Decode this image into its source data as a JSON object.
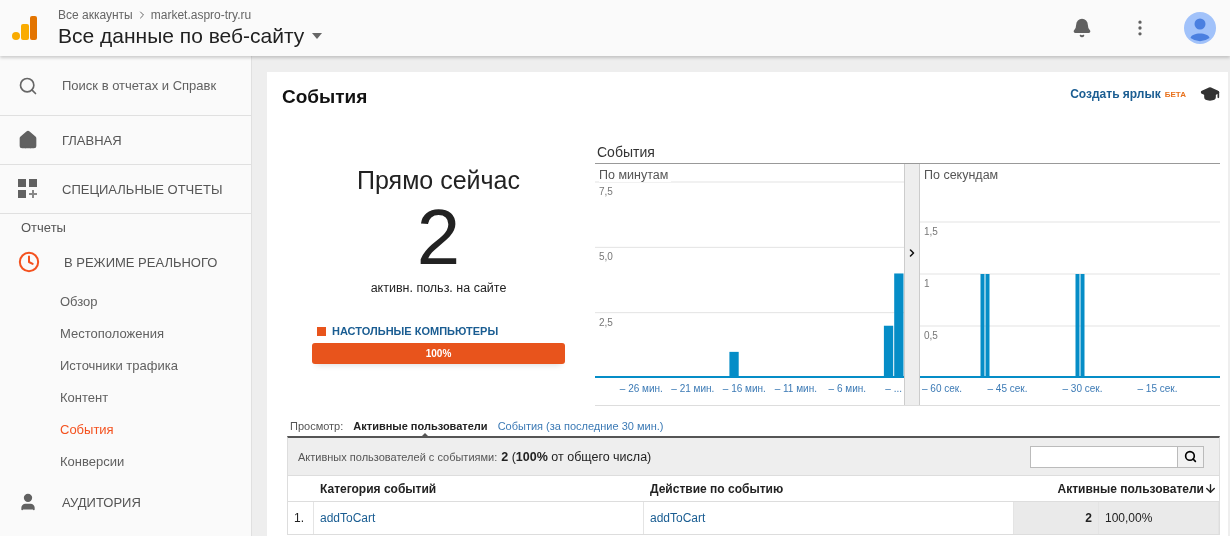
{
  "header": {
    "breadcrumb": [
      "Все аккаунты",
      "market.aspro-try.ru"
    ],
    "title": "Все данные по веб-сайту"
  },
  "sidebar": {
    "search": {
      "placeholder": "Поиск в отчетах и Справк"
    },
    "items": [
      {
        "kind": "home",
        "label": "ГЛАВНАЯ"
      },
      {
        "kind": "custom",
        "label": "СПЕЦИАЛЬНЫЕ ОТЧЕТЫ"
      },
      {
        "kind": "heading",
        "label": "Отчеты"
      },
      {
        "kind": "realtime",
        "label": "В РЕЖИМЕ РЕАЛЬНОГО",
        "expanded": true,
        "children": [
          {
            "label": "Обзор",
            "selected": false
          },
          {
            "label": "Местоположения",
            "selected": false
          },
          {
            "label": "Источники трафика",
            "selected": false
          },
          {
            "label": "Контент",
            "selected": false
          },
          {
            "label": "События",
            "selected": true
          },
          {
            "label": "Конверсии",
            "selected": false
          }
        ]
      },
      {
        "kind": "audience",
        "label": "АУДИТОРИЯ"
      }
    ]
  },
  "report": {
    "title": "События",
    "shortcut": "Создать ярлык",
    "badge": "БЕТА",
    "now": {
      "heading": "Прямо сейчас",
      "count": "2",
      "caption": "активн. польз. на сайте",
      "device": {
        "label": "НАСТОЛЬНЫЕ КОМПЬЮТЕРЫ",
        "color": "#e8541c",
        "level": 1,
        "reading": "100%"
      }
    },
    "charts_title": "События",
    "charts": [
      {
        "chart_data": {
          "type": "bar",
          "title": "По минутам",
          "categories": [
            null,
            null,
            null,
            null,
            "– 26 мин.",
            null,
            null,
            null,
            null,
            "– 21 мин.",
            null,
            null,
            null,
            null,
            "– 16 мин.",
            null,
            null,
            null,
            null,
            "– 11 мин.",
            null,
            null,
            null,
            null,
            "– 6 мин.",
            null,
            null,
            null,
            null,
            "– ..."
          ],
          "series": [
            {
              "color": "#058dc7",
              "values": [
                0,
                0,
                0,
                0,
                0,
                0,
                0,
                0,
                0,
                0,
                0,
                0,
                0,
                1,
                0,
                0,
                0,
                0,
                0,
                0,
                0,
                0,
                0,
                0,
                0,
                0,
                0,
                0,
                2,
                4
              ]
            }
          ],
          "ylim": [
            0,
            7.5
          ],
          "yticks": [
            {
              "value": 2.5,
              "label": "2,5"
            },
            {
              "value": 5,
              "label": "5,0"
            },
            {
              "value": 7.5,
              "label": "7,5"
            }
          ],
          "grid": true
        }
      },
      {
        "chart_data": {
          "type": "bar",
          "title": "По секундам",
          "categories": [
            null,
            null,
            "– 60 сек.",
            null,
            null,
            null,
            null,
            null,
            null,
            null,
            null,
            null,
            null,
            null,
            null,
            null,
            null,
            "– 45 сек.",
            null,
            null,
            null,
            null,
            null,
            null,
            null,
            null,
            null,
            null,
            null,
            null,
            null,
            null,
            "– 30 сек.",
            null,
            null,
            null,
            null,
            null,
            null,
            null,
            null,
            null,
            null,
            null,
            null,
            null,
            null,
            "– 15 сек.",
            null,
            null,
            null,
            null,
            null,
            null,
            null,
            null,
            null,
            null,
            null,
            null
          ],
          "series": [
            {
              "color": "#058dc7",
              "values": [
                null,
                null,
                null,
                null,
                null,
                null,
                null,
                null,
                null,
                null,
                null,
                null,
                1,
                1,
                null,
                null,
                null,
                null,
                null,
                null,
                null,
                null,
                null,
                null,
                null,
                null,
                null,
                null,
                null,
                null,
                null,
                1,
                1,
                null,
                null,
                null,
                null,
                null,
                null,
                null,
                null,
                null,
                null,
                null,
                null,
                null,
                null,
                null,
                null,
                null,
                null,
                null,
                null,
                null,
                null,
                null,
                null,
                null,
                null,
                null
              ]
            }
          ],
          "ylim": [
            0,
            2
          ],
          "yticks": [
            {
              "value": 0.5,
              "label": "0,5"
            },
            {
              "value": 1,
              "label": "1"
            },
            {
              "value": 1.5,
              "label": "1,5"
            }
          ],
          "grid": true
        }
      }
    ],
    "view": {
      "label": "Просмотр:",
      "tabs": [
        {
          "label": "Активные пользователи",
          "selected": true
        },
        {
          "label": "События (за последние 30 мин.)",
          "selected": false
        }
      ]
    },
    "summary": {
      "label": "Активных пользователей с событиями:",
      "value": "**2** (**100%** от общего числа)"
    },
    "table": {
      "columns": [
        {
          "label": "Категория событий",
          "sorted": false
        },
        {
          "label": "Действие по событию",
          "sorted": false
        },
        {
          "label": "Активные пользователи",
          "sorted": true
        }
      ],
      "rows": [
        {
          "index": "1.",
          "category": "addToCart",
          "action": "addToCart",
          "users": "2",
          "share": "100,00%"
        }
      ]
    }
  }
}
